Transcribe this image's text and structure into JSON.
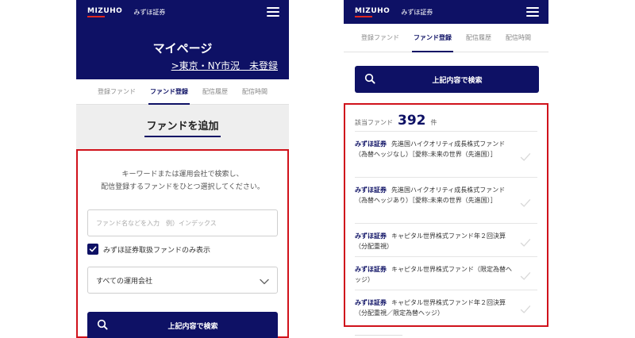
{
  "header": {
    "logo": "MIZUHO",
    "logo_text": "みずほ証券"
  },
  "mypage": {
    "title": "マイページ",
    "link": ">東京・NY市況　未登録"
  },
  "tabs": [
    {
      "label": "登録ファンド",
      "active": false
    },
    {
      "label": "ファンド登録",
      "active": true
    },
    {
      "label": "配信履歴",
      "active": false
    },
    {
      "label": "配信時間",
      "active": false
    }
  ],
  "add_fund": {
    "title": "ファンドを追加",
    "instruction_line1": "キーワードまたは運用会社で検索し、",
    "instruction_line2": "配信登録するファンドをひとつ選択してください。",
    "search_placeholder": "ファンド名などを入力　例）インデックス",
    "checkbox_label": "みずほ証券取扱ファンドのみ表示",
    "checkbox_checked": true,
    "company_select": "すべての運用会社"
  },
  "search_button_label": "上記内容で検索",
  "results": {
    "count_label": "該当ファンド",
    "count": "392",
    "count_unit": "件",
    "items": [
      {
        "brand": "みずほ証券",
        "name": "先進国ハイクオリティ成長株式ファンド（為替ヘッジなし）［愛称:未来の世界（先進国）］"
      },
      {
        "brand": "みずほ証券",
        "name": "先進国ハイクオリティ成長株式ファンド（為替ヘッジあり）［愛称:未来の世界（先進国）］"
      },
      {
        "brand": "みずほ証券",
        "name": "キャピタル世界株式ファンド年２回決算（分配重視）"
      },
      {
        "brand": "みずほ証券",
        "name": "キャピタル世界株式ファンド（限定為替ヘッジ）"
      },
      {
        "brand": "みずほ証券",
        "name": "キャピタル世界株式ファンド年２回決算（分配重視／限定為替ヘッジ）"
      }
    ]
  },
  "colors": {
    "navy": "#0e1165",
    "highlight_red": "#d0121b",
    "logo_red": "#e0271f"
  },
  "icons": {
    "menu": "hamburger-icon",
    "search": "search-icon",
    "dropdown": "chevron-down-icon",
    "check": "check-icon",
    "checkbox": "checkbox-checked-icon"
  }
}
